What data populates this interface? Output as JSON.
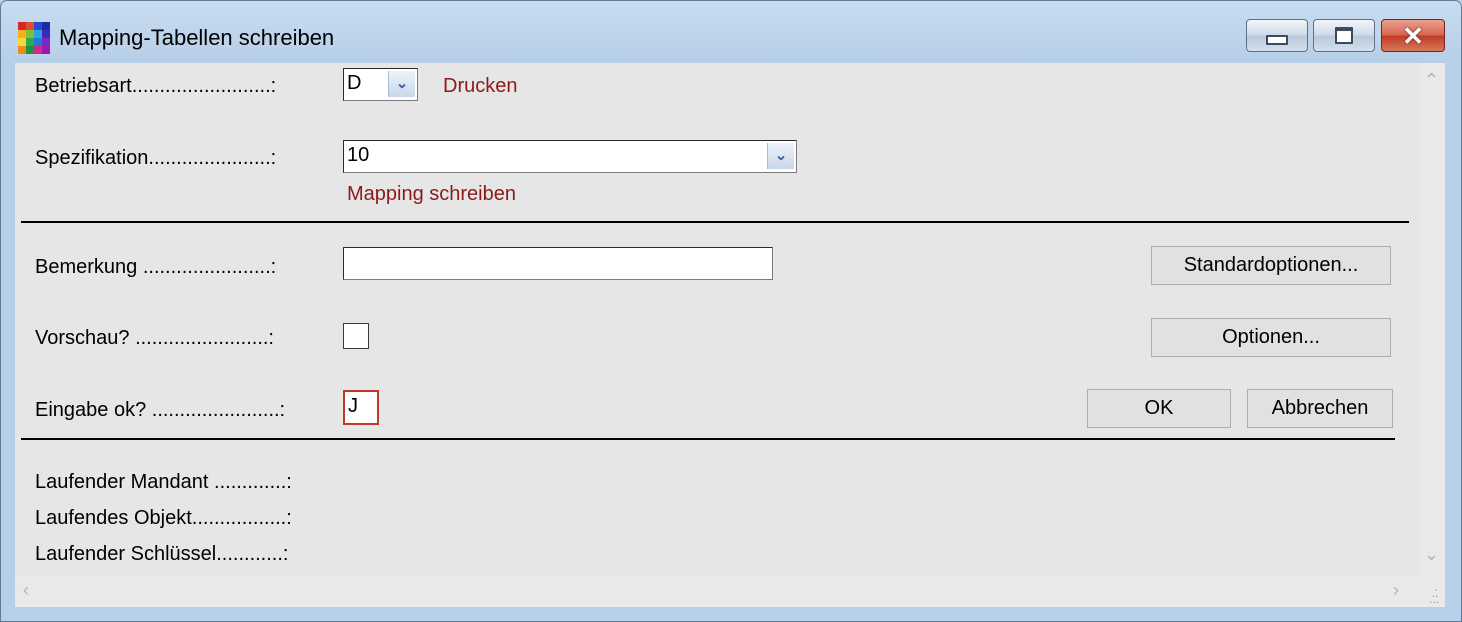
{
  "window": {
    "title": "Mapping-Tabellen schreiben",
    "buttons": {
      "minimize": "minimize",
      "maximize": "maximize",
      "close": "close"
    }
  },
  "form": {
    "betriebsart": {
      "label": "Betriebsart.........................:",
      "value": "D",
      "description": "Drucken"
    },
    "spezifikation": {
      "label": "Spezifikation......................:",
      "value": "10",
      "description": "Mapping schreiben"
    },
    "bemerkung": {
      "label": "Bemerkung .......................:",
      "value": ""
    },
    "vorschau": {
      "label": "Vorschau? ........................:",
      "checked": false
    },
    "eingabe_ok": {
      "label": "Eingabe ok? .......................:",
      "value": "J"
    }
  },
  "buttons": {
    "standardoptionen": "Standardoptionen...",
    "optionen": "Optionen...",
    "ok": "OK",
    "abbrechen": "Abbrechen"
  },
  "status": {
    "mandant_label": "Laufender Mandant .............:",
    "objekt_label": "Laufendes Objekt.................:",
    "schluessel_label": "Laufender Schlüssel............:"
  },
  "colors": {
    "description_text": "#8b1a1a",
    "client_background": "#e6e6e6",
    "title_bar": "#b7cfe8",
    "focus_border": "#c0392b"
  }
}
